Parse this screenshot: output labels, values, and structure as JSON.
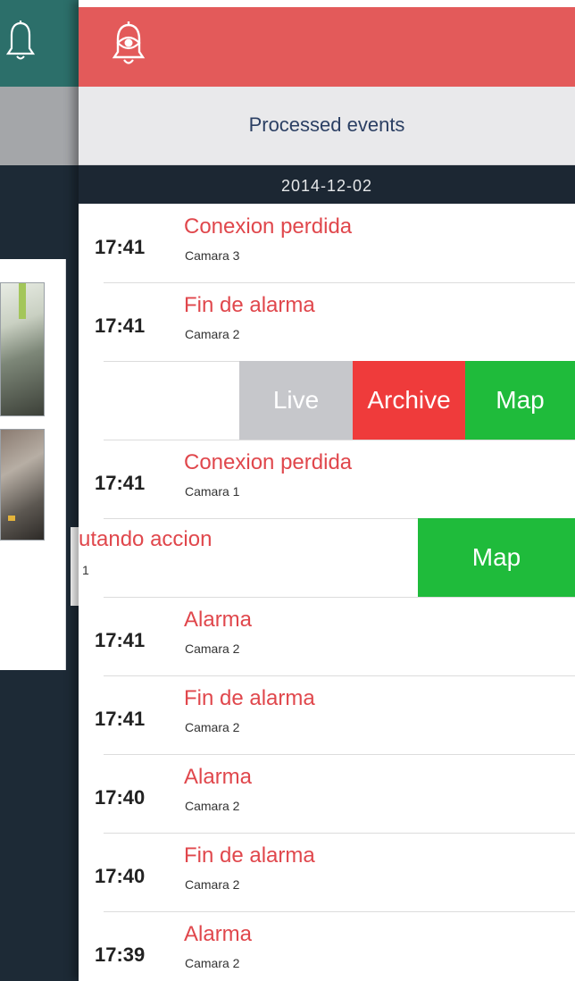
{
  "header": {
    "title": "Processed events"
  },
  "icons": {
    "left_bell": "bell-icon",
    "eye_bell": "eye-bell-icon"
  },
  "colors": {
    "accent": "#e35a5a",
    "event_title": "#e0474c",
    "map": "#1fbb3b",
    "archive": "#ef3b3b",
    "live": "#c6c7cb"
  },
  "date_header": "2014-12-02",
  "events": [
    {
      "time": "17:41",
      "title": "Conexion perdida",
      "camera": "Camara 3"
    },
    {
      "time": "17:41",
      "title": "Fin de alarma",
      "camera": "Camara 2"
    },
    {
      "time": "17:41",
      "title": "Conexion perdida",
      "camera": "Camara 1"
    },
    {
      "time": "17:41",
      "title": "Alarma",
      "camera": "Camara 2"
    },
    {
      "time": "17:41",
      "title": "Fin de alarma",
      "camera": "Camara 2"
    },
    {
      "time": "17:40",
      "title": "Alarma",
      "camera": "Camara 2"
    },
    {
      "time": "17:40",
      "title": "Fin de alarma",
      "camera": "Camara 2"
    },
    {
      "time": "17:39",
      "title": "Alarma",
      "camera": "Camara 2"
    }
  ],
  "swipe_actions_row": {
    "live": "Live",
    "archive": "Archive",
    "map": "Map"
  },
  "swipe_map_row": {
    "title_fragment": "utando accion",
    "camera_fragment": "1",
    "map": "Map"
  }
}
